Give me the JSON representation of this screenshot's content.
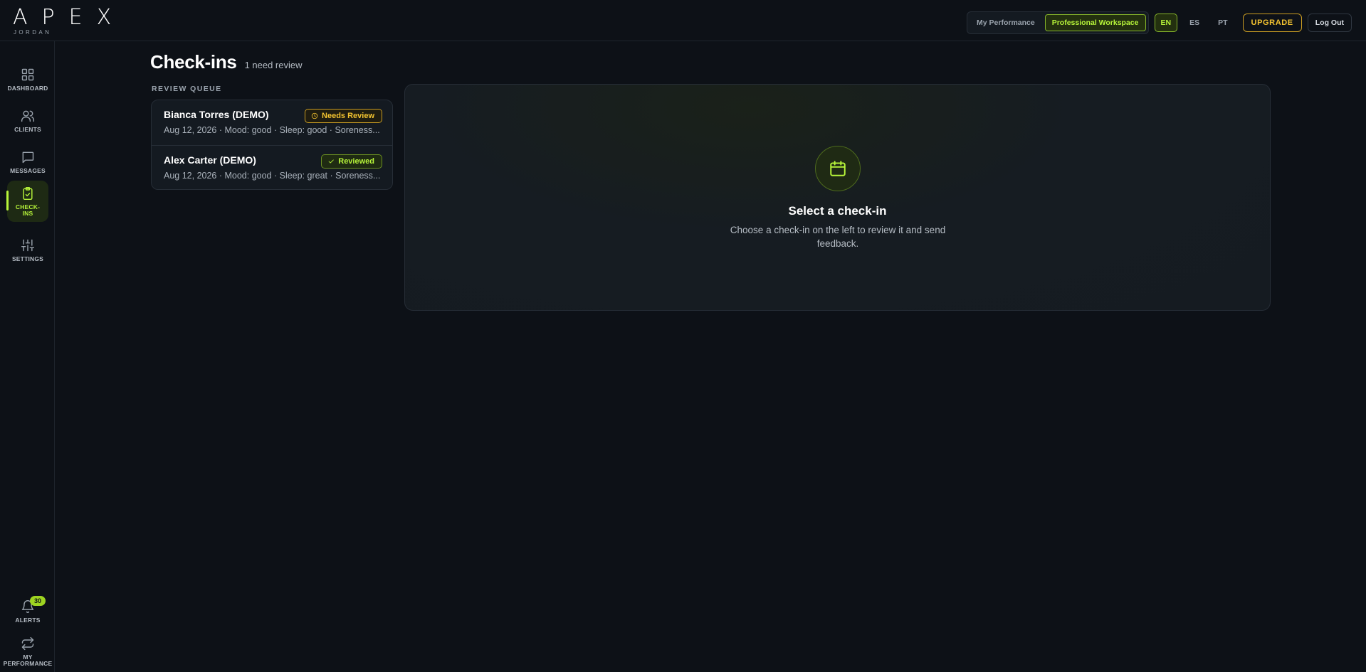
{
  "brand": {
    "logo": "APEX",
    "user": "JORDAN"
  },
  "header": {
    "workspace_toggle": [
      "My Performance",
      "Professional Workspace"
    ],
    "active_workspace": "Professional Workspace",
    "languages": [
      "EN",
      "ES",
      "PT"
    ],
    "active_language": "EN",
    "upgrade_label": "UPGRADE",
    "logout_label": "Log Out"
  },
  "sidebar": {
    "items": [
      {
        "label": "DASHBOARD",
        "icon": "grid-icon"
      },
      {
        "label": "CLIENTS",
        "icon": "users-icon"
      },
      {
        "label": "MESSAGES",
        "icon": "message-icon"
      },
      {
        "label": "CHECK-\nINS",
        "icon": "clipboard-check-icon",
        "active": true
      },
      {
        "label": "SETTINGS",
        "icon": "sliders-icon"
      }
    ],
    "bottom": [
      {
        "label": "ALERTS",
        "icon": "bell-icon",
        "badge": "30"
      },
      {
        "label": "MY\nPERFORMANCE",
        "icon": "switch-icon"
      }
    ]
  },
  "page": {
    "title": "Check-ins",
    "subtitle": "1 need review",
    "queue_label": "REVIEW QUEUE"
  },
  "queue": [
    {
      "name": "Bianca Torres (DEMO)",
      "meta": "Aug 12, 2026 · Mood: good · Sleep: good · Soreness...",
      "status": "Needs Review"
    },
    {
      "name": "Alex Carter (DEMO)",
      "meta": "Aug 12, 2026 · Mood: good · Sleep: great · Soreness...",
      "status": "Reviewed"
    }
  ],
  "detail": {
    "empty_title": "Select a check-in",
    "empty_text": "Choose a check-in on the left to review it and send feedback."
  },
  "colors": {
    "accent": "#b7f53a",
    "warning": "#f2c230",
    "background": "#0d1117",
    "panel": "#141a21"
  }
}
